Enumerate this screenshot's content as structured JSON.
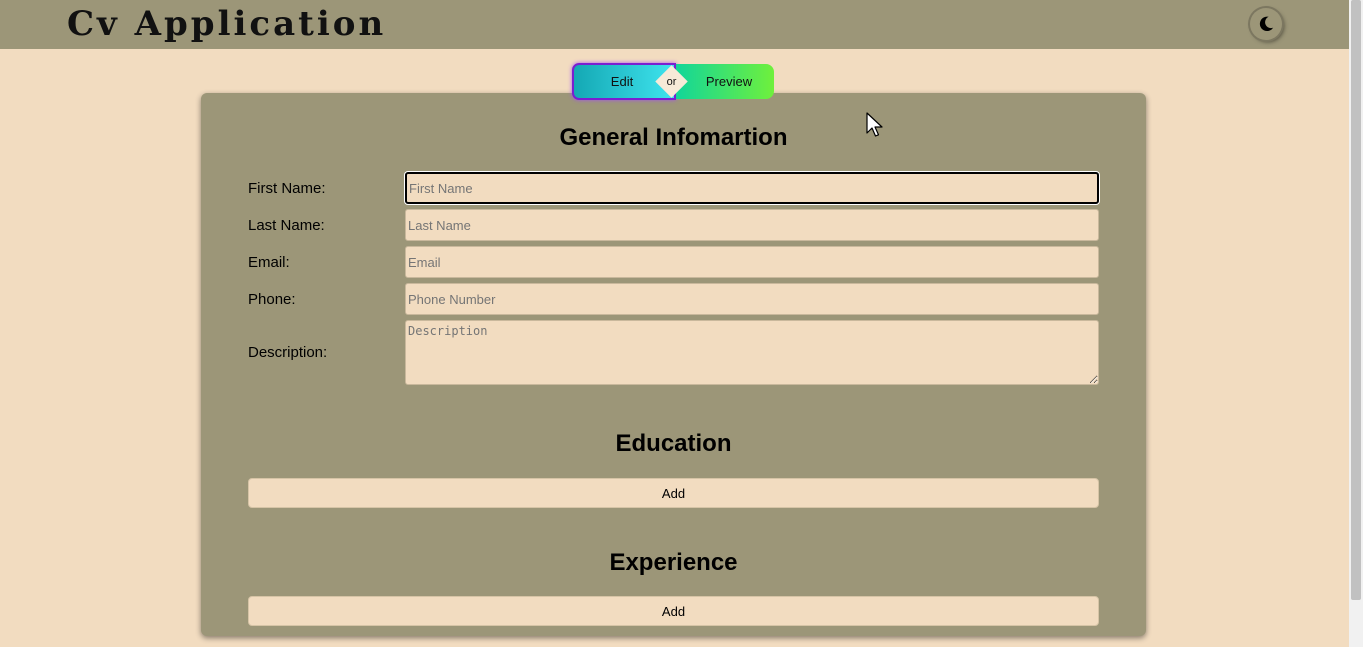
{
  "header": {
    "title": "Cv Application",
    "theme_toggle_icon": "moon-icon"
  },
  "mode_toggle": {
    "edit_label": "Edit",
    "separator": "or",
    "preview_label": "Preview"
  },
  "general": {
    "title": "General Infomartion",
    "fields": [
      {
        "label": "First Name:",
        "placeholder": "First Name"
      },
      {
        "label": "Last Name:",
        "placeholder": "Last Name"
      },
      {
        "label": "Email:",
        "placeholder": "Email"
      },
      {
        "label": "Phone:",
        "placeholder": "Phone Number"
      }
    ],
    "description": {
      "label": "Description:",
      "placeholder": "Description"
    }
  },
  "education": {
    "title": "Education",
    "add_label": "Add"
  },
  "experience": {
    "title": "Experience",
    "add_label": "Add"
  },
  "colors": {
    "background": "#f2dcc0",
    "panel": "#9c9678",
    "edit_gradient": [
      "#14a8b4",
      "#3fe4ee"
    ],
    "preview_gradient": [
      "#12d699",
      "#6ff03c"
    ],
    "edit_border": "#7a1fd0"
  }
}
